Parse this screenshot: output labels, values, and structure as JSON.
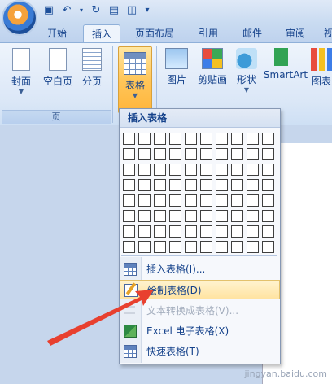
{
  "tabs": [
    {
      "label": "开始"
    },
    {
      "label": "插入"
    },
    {
      "label": "页面布局"
    },
    {
      "label": "引用"
    },
    {
      "label": "邮件"
    },
    {
      "label": "审阅"
    },
    {
      "label": "视"
    }
  ],
  "ribbon": {
    "group_pages_label": "页",
    "buttons": {
      "cover": "封面",
      "blank": "空白页",
      "break": "分页",
      "table": "表格",
      "picture": "图片",
      "clipart": "剪贴画",
      "shapes": "形状",
      "smartart": "SmartArt",
      "chart": "图表"
    }
  },
  "insert_table_menu": {
    "title": "插入表格",
    "grid": {
      "columns": 10,
      "rows": 8
    },
    "items": [
      {
        "label": "插入表格(I)...",
        "icon": "table-icon",
        "enabled": true
      },
      {
        "label": "绘制表格(D)",
        "icon": "draw-table-icon",
        "enabled": true
      },
      {
        "label": "文本转换成表格(V)...",
        "icon": "convert-text-icon",
        "enabled": false
      },
      {
        "label": "Excel 电子表格(X)",
        "icon": "excel-icon",
        "enabled": true
      },
      {
        "label": "快速表格(T)",
        "icon": "quick-table-icon",
        "enabled": true
      }
    ]
  },
  "watermark": "jingyan.baidu.com",
  "colors": {
    "accent": "#15428b",
    "highlight": "#ffc65a",
    "arrow": "#e8402f"
  }
}
